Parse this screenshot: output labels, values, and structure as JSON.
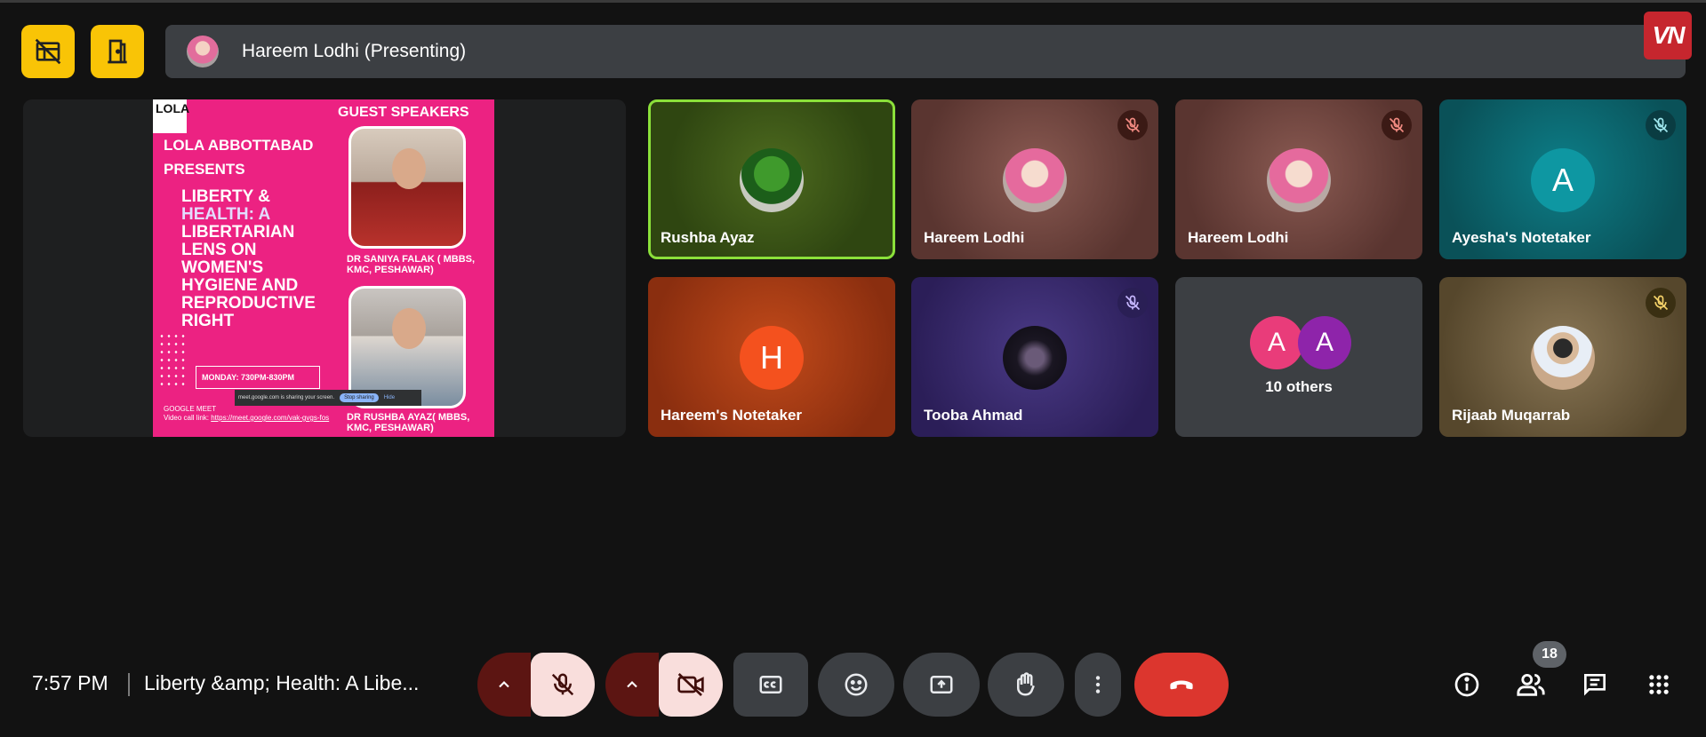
{
  "presenting_bar": {
    "text": "Hareem Lodhi (Presenting)"
  },
  "brand": {
    "logo_text": "VN"
  },
  "poster": {
    "logo_text": "LOLA",
    "guest_speakers": "GUEST SPEAKERS",
    "org_line1": "LOLA ABBOTTABAD",
    "org_line2": "PRESENTS",
    "talk_line1": "LIBERTY &",
    "talk_line2": "HEALTH: A",
    "talk_line3": "LIBERTARIAN",
    "talk_line4": "LENS ON",
    "talk_line5": "WOMEN'S",
    "talk_line6": "HYGIENE AND",
    "talk_line7": "REPRODUCTIVE",
    "talk_line8": "RIGHT",
    "speaker1": "DR SANIYA FALAK ( MBBS, KMC, PESHAWAR)",
    "speaker2": "DR RUSHBA AYAZ( MBBS, KMC, PESHAWAR)",
    "date": "MONDAY: 730PM-830PM",
    "gm_line1": "GOOGLE MEET",
    "gm_line2_label": "Video call link: ",
    "gm_link": "https://meet.google.com/vak-gvgs-fos",
    "share_text": "meet.google.com is sharing your screen.",
    "stop_sharing": "Stop sharing",
    "hide": "Hide"
  },
  "tiles": [
    {
      "name": "Rushba Ayaz",
      "muted": false
    },
    {
      "name": "Hareem Lodhi",
      "muted": true
    },
    {
      "name": "Hareem Lodhi",
      "muted": true
    },
    {
      "name": "Ayesha's Notetaker",
      "initial": "A",
      "muted": true
    },
    {
      "name": "Hareem's Notetaker",
      "initial": "H",
      "muted": false
    },
    {
      "name": "Tooba Ahmad",
      "muted": true
    },
    {
      "name": "10 others",
      "initials": [
        "A",
        "A"
      ]
    },
    {
      "name": "Rijaab Muqarrab",
      "muted": true
    }
  ],
  "bottom": {
    "time": "7:57 PM",
    "meeting_title": "Liberty &amp; Health: A Libe...",
    "participants_count": "18"
  },
  "colors": {
    "accent_yellow": "#f9c406",
    "hangup_red": "#dc362e",
    "active_speaker": "#8be03a"
  }
}
